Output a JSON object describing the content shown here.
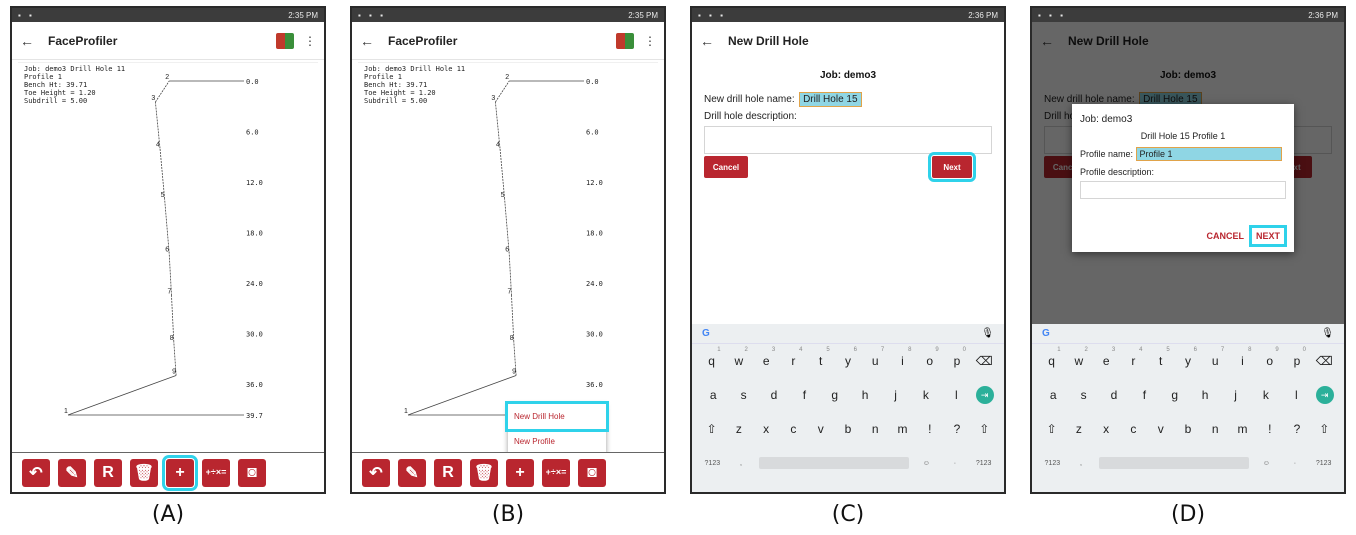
{
  "captions": [
    "(A)",
    "(B)",
    "(C)",
    "(D)"
  ],
  "status": {
    "time_a": "2:35 PM",
    "time_b": "2:35 PM",
    "time_c": "2:36 PM",
    "time_d": "2:36 PM"
  },
  "app": {
    "title": "FaceProfiler",
    "back_icon": "arrow-left-icon",
    "menu_icon": "more-vert-icon"
  },
  "profile_info": {
    "line1": "Job: demo3 Drill Hole 11",
    "line2": "Profile 1",
    "line3": "Bench Ht: 39.71",
    "line4": "Toe Height = 1.20",
    "line5": "Subdrill = 5.00"
  },
  "chart_data": {
    "type": "line",
    "title": "",
    "xlabel": "",
    "ylabel": "",
    "depth_ticks": [
      "0.0",
      "6.0",
      "12.0",
      "18.0",
      "24.0",
      "30.0",
      "36.0",
      "39.7"
    ],
    "points": [
      {
        "label": "1",
        "x": 0.0,
        "y": 39.7
      },
      {
        "label": "2",
        "x": 22.0,
        "y": 0.0
      },
      {
        "label": "3",
        "x": 19.0,
        "y": 2.5
      },
      {
        "label": "4",
        "x": 20.0,
        "y": 8.0
      },
      {
        "label": "5",
        "x": 21.0,
        "y": 14.0
      },
      {
        "label": "6",
        "x": 22.0,
        "y": 20.5
      },
      {
        "label": "7",
        "x": 22.5,
        "y": 25.5
      },
      {
        "label": "8",
        "x": 23.0,
        "y": 31.0
      },
      {
        "label": "9",
        "x": 23.5,
        "y": 35.0
      }
    ]
  },
  "toolbar": {
    "undo_icon": "undo-icon",
    "edit_icon": "pencil-icon",
    "r_label": "R",
    "trash_icon": "trash-icon",
    "add_label": "+",
    "calc_label": "+÷×=",
    "camera_icon": "camera-icon"
  },
  "popup": {
    "item1": "New Drill Hole",
    "item2": "New Profile"
  },
  "new_drill_hole": {
    "title": "New Drill Hole",
    "job": "Job: demo3",
    "name_label": "New drill hole name:",
    "name_value": "Drill Hole 15",
    "desc_label": "Drill hole description:",
    "cancel": "Cancel",
    "next": "Next"
  },
  "profile_dialog": {
    "job": "Job: demo3",
    "subtitle": "Drill Hole 15  Profile 1",
    "name_label": "Profile name:",
    "name_value": "Profile 1",
    "desc_label": "Profile description:",
    "cancel": "CANCEL",
    "next": "NEXT"
  },
  "keyboard": {
    "row1": [
      "q",
      "w",
      "e",
      "r",
      "t",
      "y",
      "u",
      "i",
      "o",
      "p"
    ],
    "row1_nums": [
      "1",
      "2",
      "3",
      "4",
      "5",
      "6",
      "7",
      "8",
      "9",
      "0"
    ],
    "row2": [
      "a",
      "s",
      "d",
      "f",
      "g",
      "h",
      "j",
      "k",
      "l"
    ],
    "row3": [
      "z",
      "x",
      "c",
      "v",
      "b",
      "n",
      "m",
      "!",
      "?"
    ],
    "g_label": "G",
    "sym_label": "?123",
    "comma": ",",
    "period": "·",
    "emoji": "☺",
    "mic": "🎤"
  },
  "colors": {
    "accent": "#b9262f",
    "highlight": "#2fd2ea",
    "enter": "#2bb09a"
  }
}
